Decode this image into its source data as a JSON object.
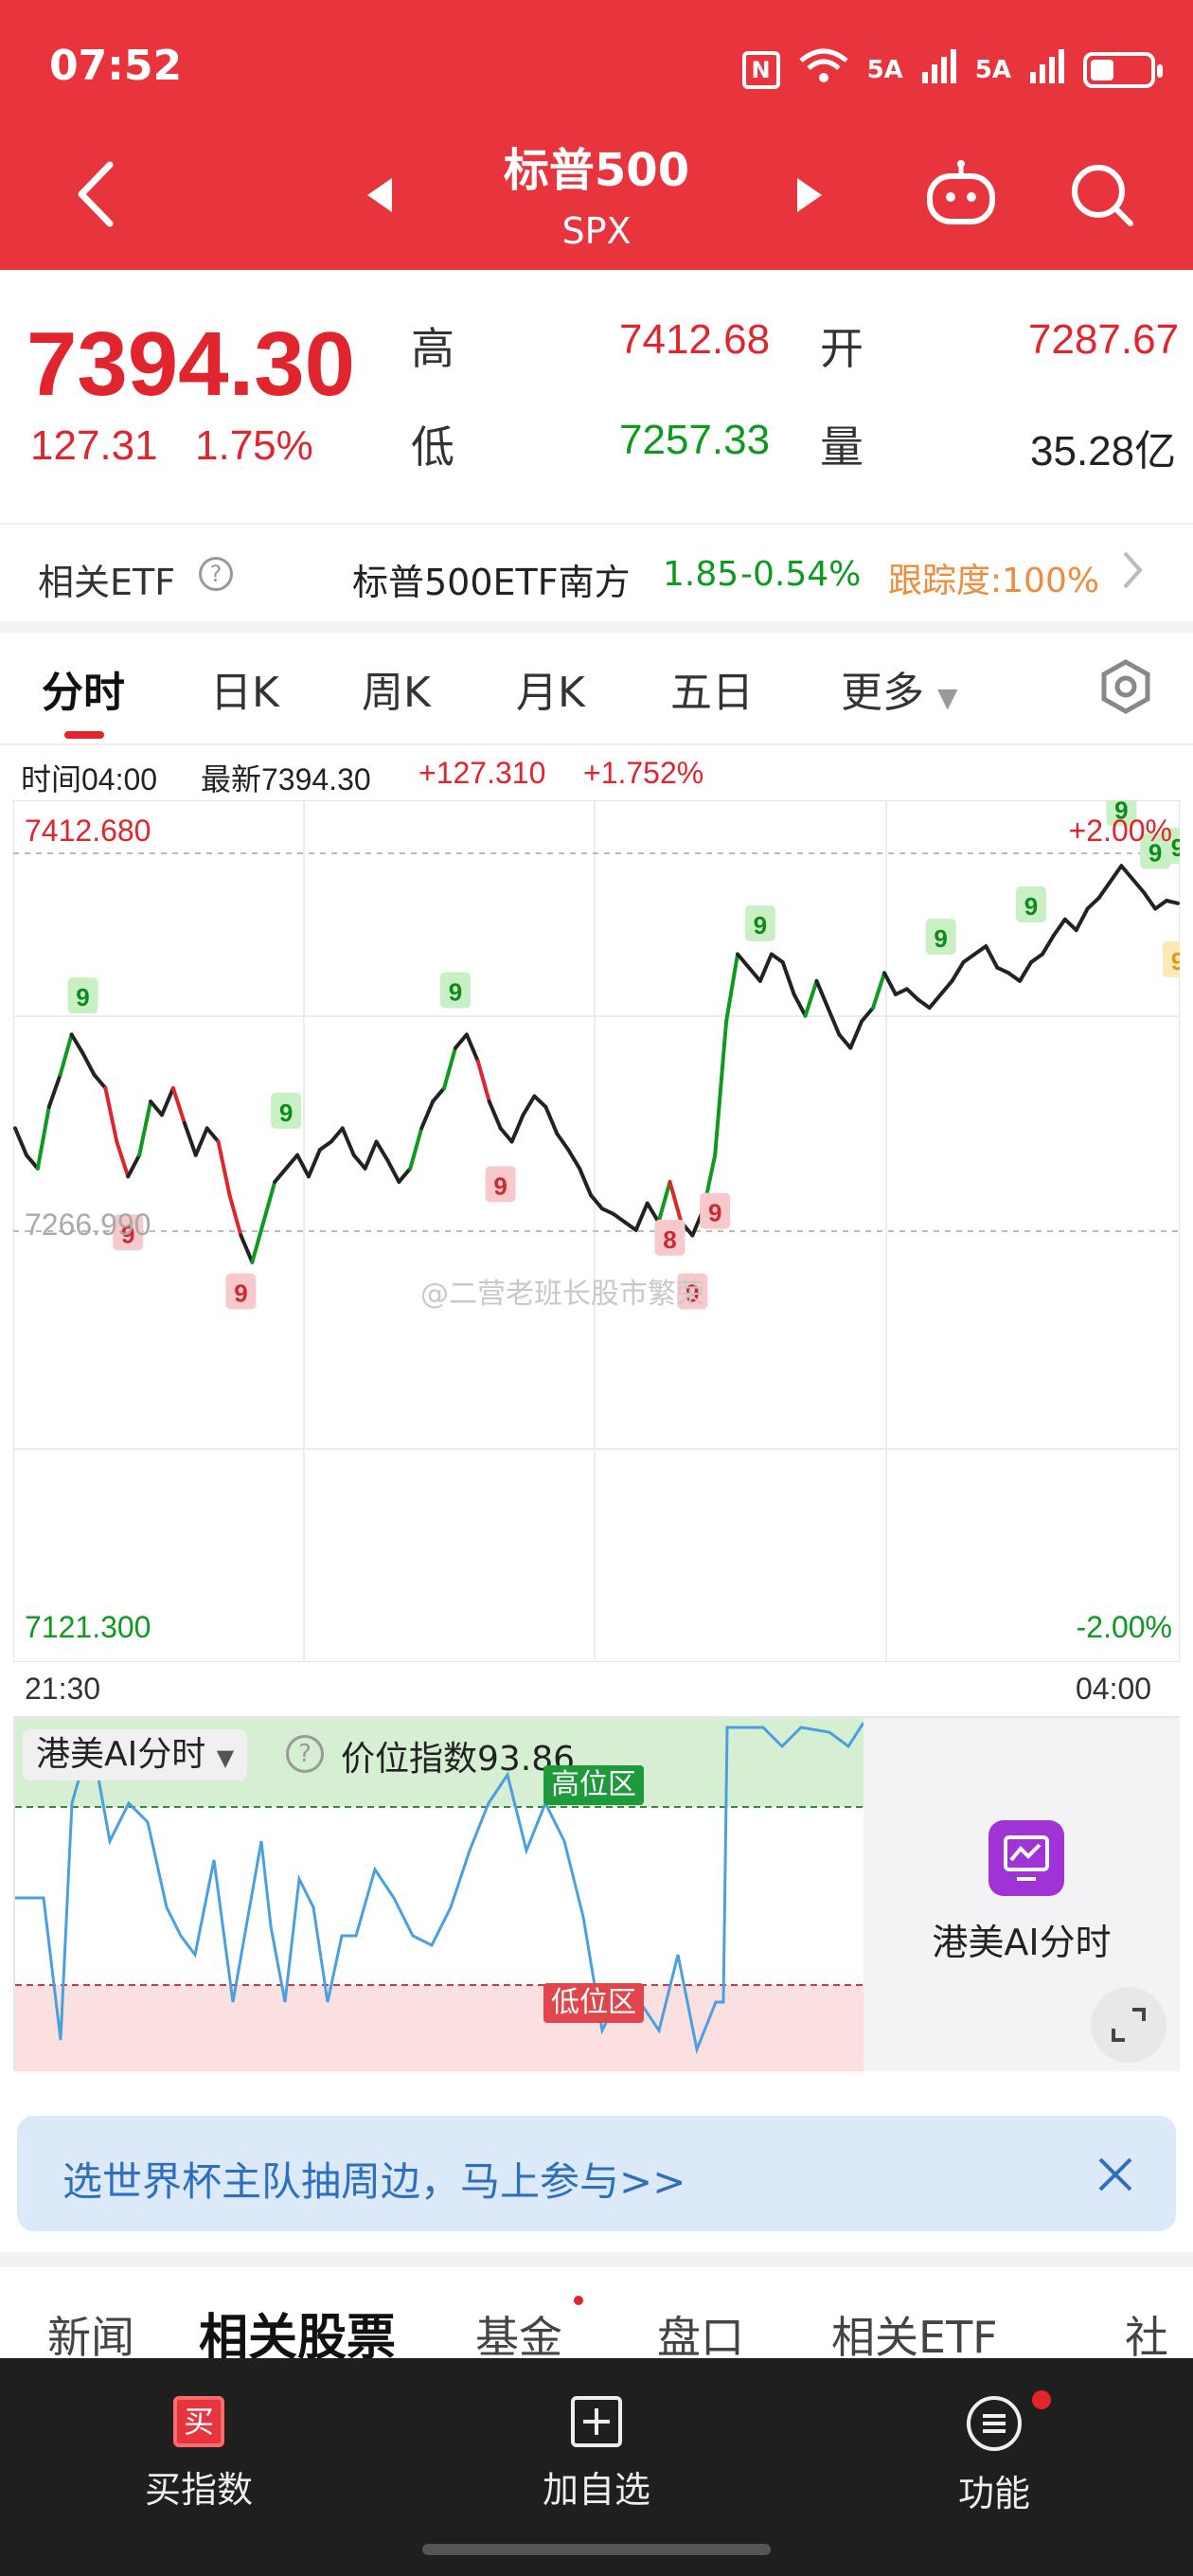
{
  "status_bar": {
    "time": "07:52",
    "signal1": "5A",
    "signal2": "5A",
    "network": "6"
  },
  "header": {
    "title": "标普500",
    "code": "SPX"
  },
  "quote": {
    "price": "7394.30",
    "change": "127.31",
    "change_pct": "1.75%",
    "high_label": "高",
    "high": "7412.68",
    "open_label": "开",
    "open": "7287.67",
    "low_label": "低",
    "low": "7257.33",
    "volume_label": "量",
    "volume": "35.28亿"
  },
  "etf_row": {
    "label": "相关ETF",
    "name": "标普500ETF南方",
    "price": "1.85",
    "change": "-0.54%",
    "tracking": "跟踪度:100%"
  },
  "tabs": [
    "分时",
    "日K",
    "周K",
    "月K",
    "五日",
    "更多"
  ],
  "info_bar": {
    "time": "时间04:00",
    "latest": "最新7394.30",
    "change": "+127.310",
    "pct": "+1.752%"
  },
  "chart_data": {
    "type": "line",
    "y_top_label": "7412.680",
    "y_mid_label": "7266.990",
    "y_bottom_label": "7121.300",
    "pct_top_label": "+2.00%",
    "pct_bottom_label": "-2.00%",
    "x_start": "21:30",
    "x_end": "04:00",
    "ylim": [
      7121.3,
      7412.68
    ],
    "values": [
      7310,
      7300,
      7295,
      7318,
      7330,
      7345,
      7338,
      7330,
      7325,
      7305,
      7292,
      7300,
      7320,
      7315,
      7325,
      7312,
      7300,
      7310,
      7305,
      7285,
      7270,
      7260,
      7275,
      7290,
      7295,
      7300,
      7292,
      7302,
      7305,
      7310,
      7300,
      7295,
      7305,
      7298,
      7290,
      7295,
      7310,
      7320,
      7325,
      7340,
      7345,
      7335,
      7320,
      7310,
      7305,
      7315,
      7322,
      7318,
      7308,
      7302,
      7295,
      7285,
      7280,
      7278,
      7275,
      7272,
      7282,
      7275,
      7290,
      7275,
      7270,
      7280,
      7300,
      7350,
      7375,
      7370,
      7365,
      7375,
      7372,
      7360,
      7352,
      7365,
      7355,
      7345,
      7340,
      7350,
      7355,
      7368,
      7360,
      7362,
      7358,
      7355,
      7360,
      7365,
      7372,
      7375,
      7378,
      7370,
      7368,
      7365,
      7372,
      7375,
      7382,
      7388,
      7384,
      7392,
      7396,
      7402,
      7408,
      7403,
      7398,
      7392,
      7395,
      7394
    ],
    "badges": [
      "9",
      "9",
      "9",
      "9",
      "9",
      "9",
      "9",
      "9",
      "9",
      "9",
      "9",
      "9",
      "9",
      "9",
      "9",
      "8"
    ]
  },
  "ai_panel": {
    "title": "港美AI分时",
    "index_label": "价位指数93.86",
    "high_zone": "高位区",
    "low_zone": "低位区",
    "side_label": "港美AI分时"
  },
  "banner": {
    "text": "选世界杯主队抽周边，马上参与>>"
  },
  "watermark": "@二营老班长股市繁荣",
  "bottom_tabs": [
    "新闻",
    "相关股票",
    "基金",
    "盘口",
    "相关ETF",
    "社区"
  ],
  "bottom_bar": [
    {
      "label": "买指数",
      "icon": "buy-icon"
    },
    {
      "label": "加自选",
      "icon": "add-icon"
    },
    {
      "label": "功能",
      "icon": "menu-icon"
    }
  ],
  "colors": {
    "header": "#e8343c",
    "up": "#e0252e",
    "down": "#0e9a1f",
    "line": "#222222"
  }
}
